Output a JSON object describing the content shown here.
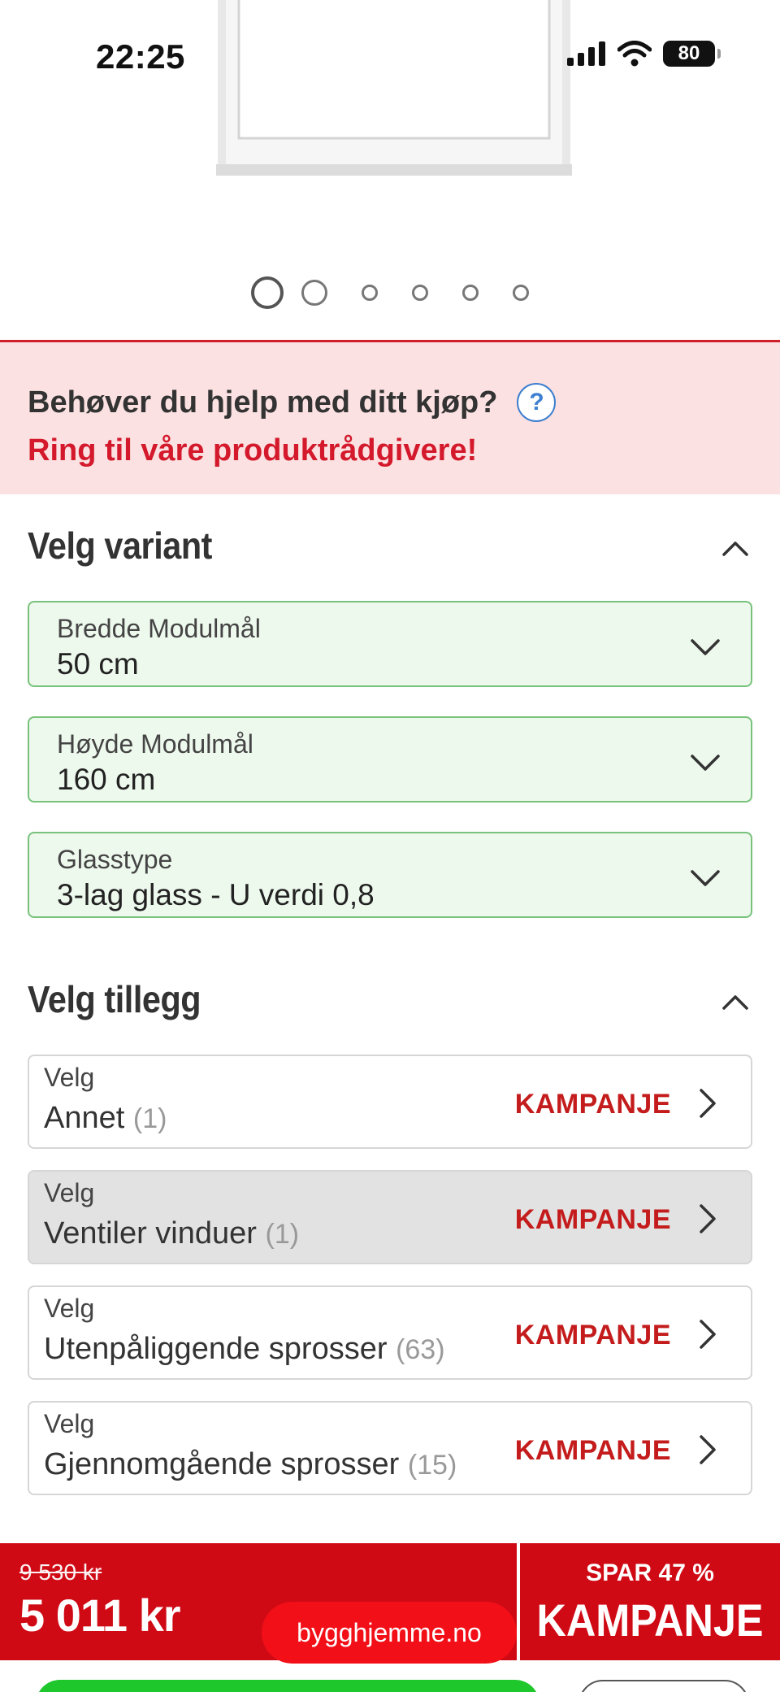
{
  "status_bar": {
    "time": "22:25",
    "battery": "80"
  },
  "gallery": {
    "image_icon": "window-product-image",
    "dot_count": 6,
    "active_index": 0
  },
  "help_banner": {
    "question": "Behøver du hjelp med ditt kjøp?",
    "help_icon": "?",
    "cta": "Ring til våre produktrådgivere!"
  },
  "variant_section": {
    "title": "Velg variant",
    "selects": [
      {
        "label": "Bredde Modulmål",
        "value": "50 cm"
      },
      {
        "label": "Høyde Modulmål",
        "value": "160 cm"
      },
      {
        "label": "Glasstype",
        "value": "3-lag glass - U verdi 0,8"
      }
    ]
  },
  "addon_section": {
    "title": "Velg tillegg",
    "items": [
      {
        "prefix": "Velg",
        "name": "Annet",
        "count": "(1)",
        "badge": "KAMPANJE"
      },
      {
        "prefix": "Velg",
        "name": "Ventiler vinduer",
        "count": "(1)",
        "badge": "KAMPANJE"
      },
      {
        "prefix": "Velg",
        "name": "Utenpåliggende sprosser",
        "count": "(63)",
        "badge": "KAMPANJE"
      },
      {
        "prefix": "Velg",
        "name": "Gjennomgående sprosser",
        "count": "(15)",
        "badge": "KAMPANJE"
      }
    ]
  },
  "price_bar": {
    "old_price": "9 530 kr",
    "new_price": "5 011 kr",
    "save_text": "SPAR 47 %",
    "campaign": "KAMPANJE",
    "site": "bygghjemme.no"
  },
  "colors": {
    "brand_red": "#cf0a15",
    "badge_red": "#c41c1c",
    "select_green_border": "#78c27b",
    "select_green_bg": "#eef9ee",
    "help_bg": "#fbe1e1",
    "buy_green": "#1ec72c"
  }
}
